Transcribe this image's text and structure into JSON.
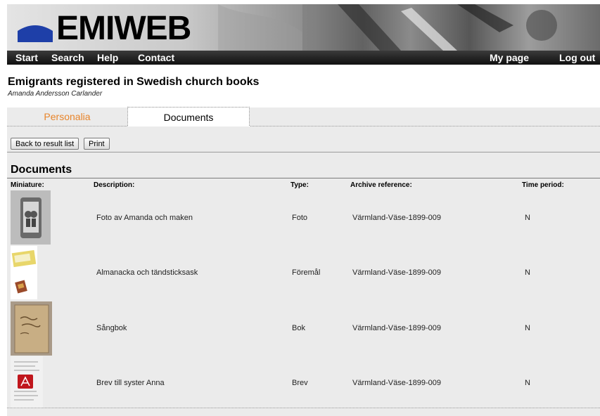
{
  "brand": {
    "logo_text": "EMIWEB"
  },
  "nav": {
    "start": "Start",
    "search": "Search",
    "help": "Help",
    "contact": "Contact",
    "my_page": "My page",
    "log_out": "Log out"
  },
  "page": {
    "title": "Emigrants registered in Swedish church books",
    "person": "Amanda Andersson Carlander"
  },
  "tabs": {
    "personalia": "Personalia",
    "documents": "Documents"
  },
  "buttons": {
    "back": "Back to result list",
    "print": "Print"
  },
  "documents": {
    "heading": "Documents",
    "columns": {
      "miniature": "Miniature:",
      "description": "Description:",
      "type": "Type:",
      "archive": "Archive reference:",
      "period": "Time period:"
    },
    "rows": [
      {
        "description": "Foto av Amanda och maken",
        "type": "Foto",
        "archive": "Värmland-Väse-1899-009",
        "period": "N",
        "thumb": "photo-frame-icon"
      },
      {
        "description": "Almanacka och tändsticksask",
        "type": "Föremål",
        "archive": "Värmland-Väse-1899-009",
        "period": "N",
        "thumb": "matchbox-icon"
      },
      {
        "description": "Sångbok",
        "type": "Bok",
        "archive": "Värmland-Väse-1899-009",
        "period": "N",
        "thumb": "songbook-icon"
      },
      {
        "description": "Brev till syster Anna",
        "type": "Brev",
        "archive": "Värmland-Väse-1899-009",
        "period": "N",
        "thumb": "pdf-letter-icon"
      }
    ]
  }
}
